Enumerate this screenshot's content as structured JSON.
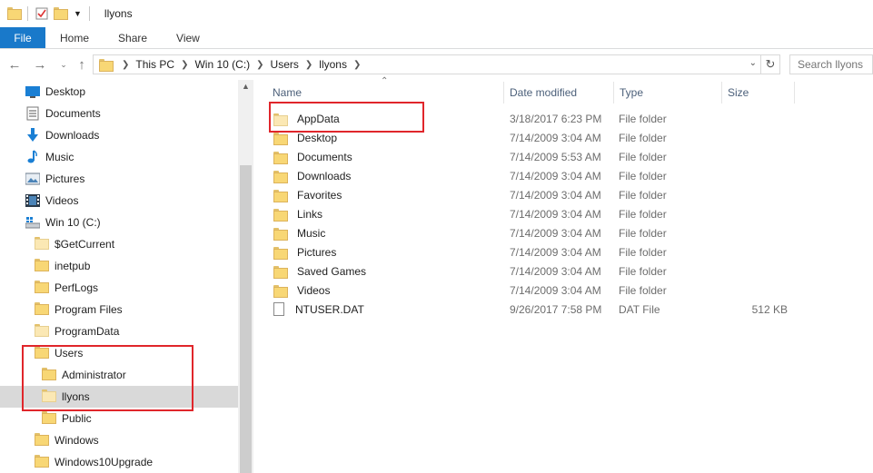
{
  "window": {
    "title": "llyons"
  },
  "ribbon": {
    "tabs": [
      "File",
      "Home",
      "Share",
      "View"
    ]
  },
  "address": {
    "crumbs": [
      "This PC",
      "Win 10 (C:)",
      "Users",
      "llyons"
    ],
    "search_placeholder": "Search llyons"
  },
  "nav": {
    "quick": [
      {
        "label": "Desktop",
        "icon": "desktop-icon"
      },
      {
        "label": "Documents",
        "icon": "documents-icon"
      },
      {
        "label": "Downloads",
        "icon": "downloads-icon"
      },
      {
        "label": "Music",
        "icon": "music-icon"
      },
      {
        "label": "Pictures",
        "icon": "pictures-icon"
      },
      {
        "label": "Videos",
        "icon": "videos-icon"
      },
      {
        "label": "Win 10 (C:)",
        "icon": "drive-icon"
      }
    ],
    "drive_folders": [
      "$GetCurrent",
      "inetpub",
      "PerfLogs",
      "Program Files",
      "ProgramData",
      "Users"
    ],
    "user_folders": [
      "Administrator",
      "llyons",
      "Public"
    ],
    "after": [
      "Windows",
      "Windows10Upgrade"
    ],
    "selected": "llyons"
  },
  "columns": {
    "name": "Name",
    "date": "Date modified",
    "type": "Type",
    "size": "Size"
  },
  "files": [
    {
      "name": "AppData",
      "date": "3/18/2017 6:23 PM",
      "type": "File folder",
      "size": "",
      "kind": "folder-light"
    },
    {
      "name": "Desktop",
      "date": "7/14/2009 3:04 AM",
      "type": "File folder",
      "size": "",
      "kind": "folder"
    },
    {
      "name": "Documents",
      "date": "7/14/2009 5:53 AM",
      "type": "File folder",
      "size": "",
      "kind": "folder"
    },
    {
      "name": "Downloads",
      "date": "7/14/2009 3:04 AM",
      "type": "File folder",
      "size": "",
      "kind": "folder"
    },
    {
      "name": "Favorites",
      "date": "7/14/2009 3:04 AM",
      "type": "File folder",
      "size": "",
      "kind": "folder"
    },
    {
      "name": "Links",
      "date": "7/14/2009 3:04 AM",
      "type": "File folder",
      "size": "",
      "kind": "folder"
    },
    {
      "name": "Music",
      "date": "7/14/2009 3:04 AM",
      "type": "File folder",
      "size": "",
      "kind": "folder"
    },
    {
      "name": "Pictures",
      "date": "7/14/2009 3:04 AM",
      "type": "File folder",
      "size": "",
      "kind": "folder"
    },
    {
      "name": "Saved Games",
      "date": "7/14/2009 3:04 AM",
      "type": "File folder",
      "size": "",
      "kind": "folder"
    },
    {
      "name": "Videos",
      "date": "7/14/2009 3:04 AM",
      "type": "File folder",
      "size": "",
      "kind": "folder"
    },
    {
      "name": "NTUSER.DAT",
      "date": "9/26/2017 7:58 PM",
      "type": "DAT File",
      "size": "512 KB",
      "kind": "file"
    }
  ],
  "colors": {
    "accent": "#1979ca",
    "highlight": "#e0262b",
    "folder": "#f8d775"
  }
}
